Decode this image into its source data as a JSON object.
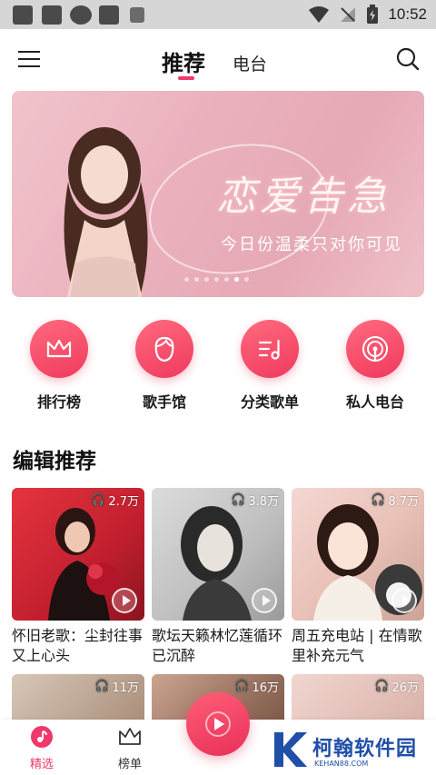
{
  "status_bar": {
    "time": "10:52"
  },
  "top_nav": {
    "tabs": [
      {
        "label": "推荐",
        "active": true
      },
      {
        "label": "电台",
        "active": false
      }
    ]
  },
  "banner": {
    "title": "恋爱告急",
    "subtitle": "今日份温柔只对你可见",
    "dot_count": 7,
    "active_dot": 6
  },
  "quick_entries": [
    {
      "label": "排行榜",
      "icon": "crown-icon"
    },
    {
      "label": "歌手馆",
      "icon": "singer-face-icon"
    },
    {
      "label": "分类歌单",
      "icon": "music-list-icon"
    },
    {
      "label": "私人电台",
      "icon": "radio-icon"
    }
  ],
  "section": {
    "title": "编辑推荐"
  },
  "cards": [
    {
      "count": "2.7万",
      "title": "怀旧老歌：尘封往事又上心头"
    },
    {
      "count": "3.8万",
      "title": "歌坛天籁林忆莲循环已沉醉"
    },
    {
      "count": "8.7万",
      "title": "周五充电站 | 在情歌里补充元气"
    }
  ],
  "cards_row2": [
    {
      "count": "11万"
    },
    {
      "count": "16万"
    },
    {
      "count": "26万"
    }
  ],
  "bottom_nav": {
    "items": [
      {
        "label": "精选",
        "active": true
      },
      {
        "label": "榜单",
        "active": false
      }
    ]
  },
  "watermark": {
    "text": "柯翰软件园",
    "sub": "KEHAN88.COM"
  },
  "colors": {
    "accent": "#f0386a",
    "banner_bg": "#eab1bd"
  }
}
